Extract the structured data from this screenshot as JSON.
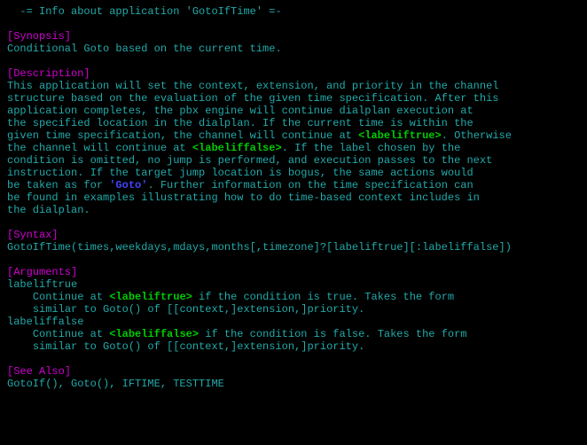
{
  "title": "  -= Info about application 'GotoIfTime' =-",
  "sections": {
    "synopsis": {
      "heading": "[Synopsis]",
      "text": "Conditional Goto based on the current time."
    },
    "description": {
      "heading": "[Description]",
      "p1": "This application will set the context, extension, and priority in the channel",
      "p2": "structure based on the evaluation of the given time specification. After this",
      "p3": "application completes, the pbx engine will continue dialplan execution at",
      "p4": "the specified location in the dialplan. If the current time is within the",
      "p5a": "given time specification, the channel will continue at ",
      "lt": "<labeliftrue>",
      "p5b": ". Otherwise",
      "p6a": "the channel will continue at ",
      "lf": "<labeliffalse>",
      "p6b": ". If the label chosen by the",
      "p7": "condition is omitted, no jump is performed, and execution passes to the next",
      "p8": "instruction. If the target jump location is bogus, the same actions would",
      "p9a": "be taken as for ",
      "goto": "'Goto'",
      "p9b": ". Further information on the time specification can",
      "p10": "be found in examples illustrating how to do time-based context includes in",
      "p11": "the dialplan."
    },
    "syntax": {
      "heading": "[Syntax]",
      "text": "GotoIfTime(times,weekdays,mdays,months[,timezone]?[labeliftrue][:labeliffalse])"
    },
    "arguments": {
      "heading": "[Arguments]",
      "lt_name": "labeliftrue",
      "lt_l1a": "    Continue at ",
      "lt_tag": "<labeliftrue>",
      "lt_l1b": " if the condition is true. Takes the form",
      "lt_l2": "    similar to Goto() of [[context,]extension,]priority.",
      "lf_name": "labeliffalse",
      "lf_l1a": "    Continue at ",
      "lf_tag": "<labeliffalse>",
      "lf_l1b": " if the condition is false. Takes the form",
      "lf_l2": "    similar to Goto() of [[context,]extension,]priority."
    },
    "seealso": {
      "heading": "[See Also]",
      "text": "GotoIf(), Goto(), IFTIME, TESTTIME"
    }
  }
}
